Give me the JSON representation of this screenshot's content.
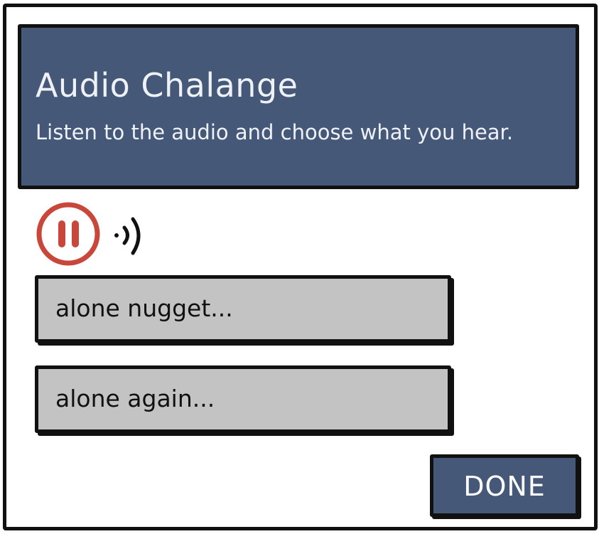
{
  "dialog": {
    "title": "Audio Chalange",
    "subtitle": "Listen to the audio and choose what you hear."
  },
  "player": {
    "state": "playing",
    "pause_icon": "pause-icon",
    "volume_icon": "volume-icon"
  },
  "options": [
    {
      "label": "alone nugget..."
    },
    {
      "label": "alone again..."
    }
  ],
  "actions": {
    "done_label": "DONE"
  },
  "colors": {
    "header_bg": "#455878",
    "option_bg": "#c3c3c3",
    "pause_accent": "#c9473a",
    "outline": "#111111"
  }
}
